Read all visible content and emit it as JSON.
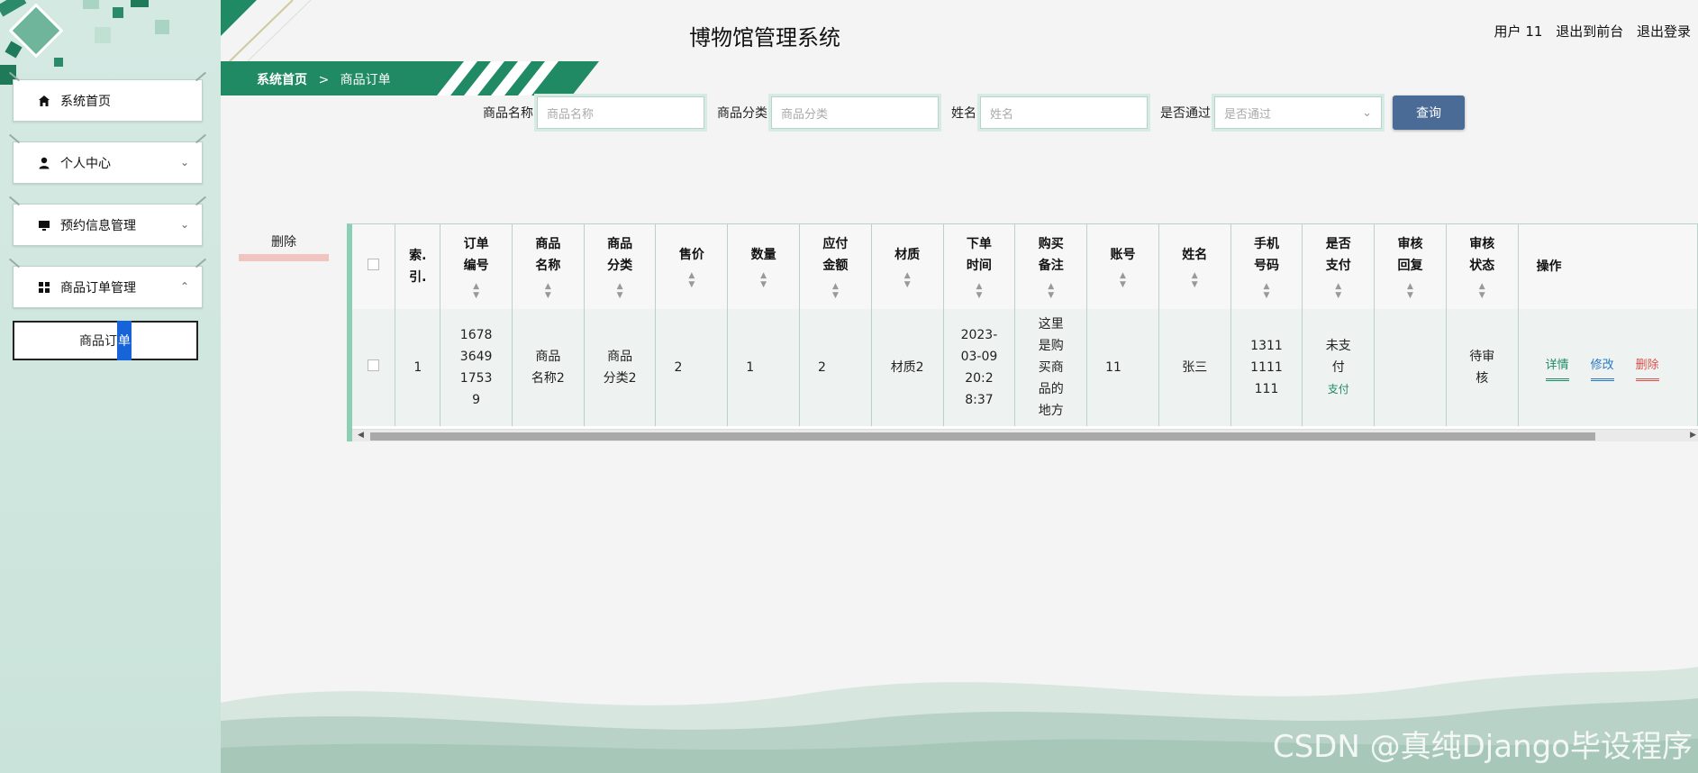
{
  "header": {
    "title": "博物馆管理系统",
    "user": "用户 11",
    "back_front": "退出到前台",
    "logout": "退出登录"
  },
  "breadcrumb": {
    "home": "系统首页",
    "sep": ">",
    "current": "商品订单"
  },
  "sidebar": {
    "items": [
      {
        "label": "系统首页",
        "icon": "home-icon"
      },
      {
        "label": "个人中心",
        "icon": "user-icon"
      },
      {
        "label": "预约信息管理",
        "icon": "monitor-icon"
      },
      {
        "label": "商品订单管理",
        "icon": "grid-icon"
      }
    ],
    "sub_item_a": "商品订",
    "sub_item_b": "单"
  },
  "search": {
    "name_label": "商品名称",
    "name_placeholder": "商品名称",
    "category_label": "商品分类",
    "category_placeholder": "商品分类",
    "person_label": "姓名",
    "person_placeholder": "姓名",
    "passed_label": "是否通过",
    "passed_placeholder": "是否通过",
    "query_button": "查询"
  },
  "actions": {
    "delete_button": "删除"
  },
  "table": {
    "headers": [
      "索.引.",
      "订单编号",
      "商品名称",
      "商品分类",
      "售价",
      "数量",
      "应付金额",
      "材质",
      "下单时间",
      "购买备注",
      "账号",
      "姓名",
      "手机号码",
      "是否支付",
      "审核回复",
      "审核状态",
      "操作"
    ],
    "h": {
      "index_a": "索.",
      "index_b": "引.",
      "order_no_a": "订单",
      "order_no_b": "编号",
      "goods_name_a": "商品",
      "goods_name_b": "名称",
      "goods_cat_a": "商品",
      "goods_cat_b": "分类",
      "price": "售价",
      "qty": "数量",
      "payable_a": "应付",
      "payable_b": "金额",
      "material": "材质",
      "time_a": "下单",
      "time_b": "时间",
      "remark_a": "购买",
      "remark_b": "备注",
      "account": "账号",
      "name": "姓名",
      "phone_a": "手机",
      "phone_b": "号码",
      "paid_a": "是否",
      "paid_b": "支付",
      "reply_a": "审核",
      "reply_b": "回复",
      "status_a": "审核",
      "status_b": "状态",
      "ops": "操作"
    },
    "row": {
      "index": "1",
      "order_no_lines": [
        "1678",
        "3649",
        "1753",
        "9"
      ],
      "goods_name_lines": [
        "商品",
        "名称2"
      ],
      "goods_cat_lines": [
        "商品",
        "分类2"
      ],
      "price": "2",
      "qty": "1",
      "payable": "2",
      "material": "材质2",
      "time_lines": [
        "2023-",
        "03-09",
        "20:2",
        "8:37"
      ],
      "remark_lines": [
        "这里",
        "是购",
        "买商",
        "品的",
        "地方"
      ],
      "account": "11",
      "name": "张三",
      "phone_lines": [
        "1311",
        "1111",
        "111"
      ],
      "paid_lines": [
        "未支",
        "付"
      ],
      "pay_link": "支付",
      "reply": "",
      "status_lines": [
        "待审",
        "核"
      ],
      "detail": "详情",
      "edit": "修改",
      "delete": "删除"
    }
  },
  "watermark": "CSDN @真纯Django毕设程序",
  "colors": {
    "brand_green": "#1f8a64",
    "query_blue": "#4a6b95",
    "sidebar_bg": "#d4e9e2",
    "delete_red": "#d9534f",
    "detail_teal": "#1f8a64",
    "edit_blue": "#2a78c5"
  }
}
